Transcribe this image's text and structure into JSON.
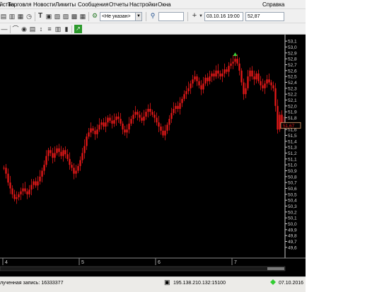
{
  "menu": {
    "items": [
      "ойства",
      "Торговля",
      "Новости",
      "Лимиты",
      "Сообщения",
      "Отчеты",
      "Настройки",
      "Окна",
      "Справка"
    ]
  },
  "toolbar": {
    "instrument_combo": "<Не указан>",
    "search_value": "",
    "datetime_field": "03.10.16 19:00",
    "price_field": "52,87"
  },
  "chart": {
    "last_price_label": "51,67",
    "accent_up": "#e61818",
    "arrow_color": "#3cd23c"
  },
  "chart_data": {
    "type": "candlestick",
    "y_ticks": [
      "53,1",
      "53,0",
      "52,9",
      "52,8",
      "52,7",
      "52,6",
      "52,5",
      "52,4",
      "52,3",
      "52,2",
      "52,1",
      "52,0",
      "51,9",
      "51,8",
      "51,7",
      "51,6",
      "51,5",
      "51,4",
      "51,3",
      "51,2",
      "51,1",
      "51,0",
      "50,9",
      "50,8",
      "50,7",
      "50,6",
      "50,5",
      "50,4",
      "50,3",
      "50,2",
      "50,1",
      "50,0",
      "49,9",
      "49,8",
      "49,7",
      "49,6"
    ],
    "ylim": [
      49.55,
      53.15
    ],
    "x_labels": [
      "4",
      "5",
      "6",
      "7"
    ],
    "x_label_dates": [
      4,
      5,
      6,
      7
    ],
    "series": [
      {
        "name": "",
        "values": [
          50.95,
          50.85,
          50.7,
          50.6,
          50.5,
          50.42,
          50.45,
          50.5,
          50.55,
          50.6,
          50.55,
          50.5,
          50.58,
          50.66,
          50.72,
          50.65,
          50.72,
          50.8,
          50.9,
          51.0,
          51.15,
          51.25,
          51.2,
          51.12,
          51.2,
          51.28,
          51.22,
          51.15,
          51.25,
          51.18,
          51.1,
          51.0,
          50.95,
          50.85,
          50.9,
          50.98,
          51.08,
          51.2,
          51.32,
          51.48,
          51.55,
          51.62,
          51.58,
          51.52,
          51.6,
          51.68,
          51.72,
          51.65,
          51.72,
          51.8,
          51.75,
          51.7,
          51.76,
          51.82,
          51.78,
          51.7,
          51.6,
          51.55,
          51.6,
          51.7,
          51.78,
          51.85,
          51.9,
          51.85,
          51.8,
          51.75,
          51.82,
          51.9,
          51.95,
          51.9,
          51.85,
          51.8,
          51.72,
          51.65,
          51.58,
          51.5,
          51.58,
          51.68,
          51.78,
          51.88,
          51.95,
          52.0,
          51.95,
          52.05,
          52.12,
          52.2,
          52.25,
          52.3,
          52.38,
          52.45,
          52.5,
          52.42,
          52.35,
          52.28,
          52.38,
          52.48,
          52.42,
          52.5,
          52.55,
          52.5,
          52.6,
          52.55,
          52.5,
          52.55,
          52.62,
          52.58,
          52.68,
          52.72,
          52.75,
          52.8,
          52.72,
          52.6,
          52.4,
          52.2,
          52.3,
          52.5,
          52.6,
          52.5,
          52.45,
          52.55,
          52.42,
          52.35,
          52.3,
          52.38,
          52.45,
          52.4,
          52.35,
          52.3,
          52.0,
          51.6,
          51.85,
          51.72,
          51.67
        ]
      }
    ]
  },
  "status": {
    "record_text": "лученная запись: 16333377",
    "server_text": "195.138.210.132:15100",
    "date_text": "07.10.2016",
    "connected_color": "#32cd32"
  }
}
